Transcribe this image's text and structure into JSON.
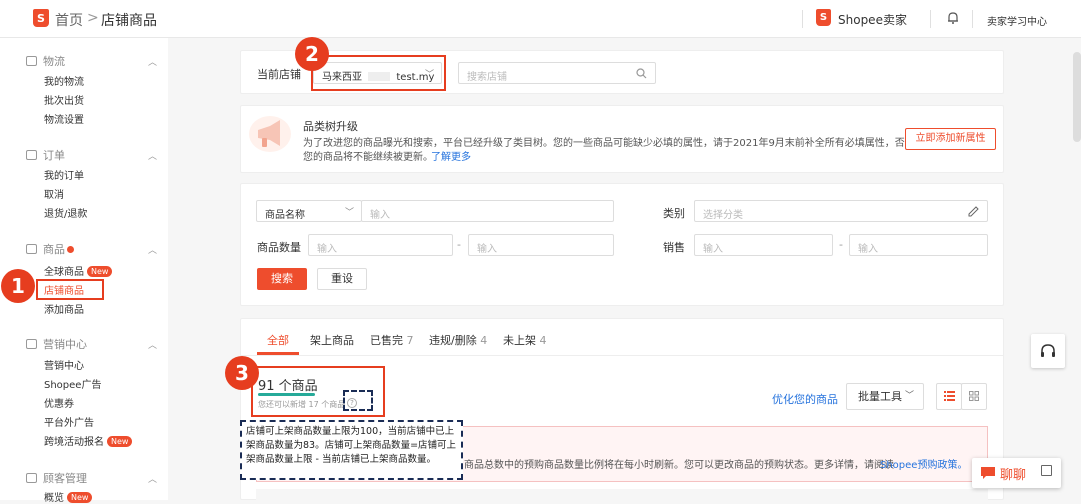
{
  "topbar": {
    "logo_glyph": "S",
    "home": "首页",
    "sep": ">",
    "current": "店铺商品",
    "brand": "Shopee卖家",
    "learn": "卖家学习中心"
  },
  "sidebar": {
    "sections": [
      {
        "label": "物流",
        "items": [
          "我的物流",
          "批次出货",
          "物流设置"
        ]
      },
      {
        "label": "订单",
        "items": [
          "我的订单",
          "取消",
          "退货/退款"
        ]
      },
      {
        "label": "商品",
        "items": [
          "全球商品",
          "店铺商品",
          "添加商品"
        ]
      },
      {
        "label": "营销中心",
        "items": [
          "营销中心",
          "Shopee广告",
          "优惠券",
          "平台外广告",
          "跨境活动报名"
        ]
      },
      {
        "label": "顾客管理",
        "items": [
          "概览"
        ]
      }
    ],
    "new_badge": "New"
  },
  "store": {
    "label": "当前店铺",
    "value_country": "马来西亚",
    "value_store": "test.my",
    "search_placeholder": "搜索店铺"
  },
  "notice": {
    "title": "品类树升级",
    "body_line1": "为了改进您的商品曝光和搜索，平台已经升级了类目树。您的一些商品可能缺少必填的属性，请于2021年9月末前补全所有必填属性，否则",
    "body_line2": "您的商品将不能继续被更新。",
    "learn_more": "了解更多",
    "action": "立即添加新属性"
  },
  "filters": {
    "name_select": "商品名称",
    "input_placeholder": "输入",
    "category_label": "类别",
    "category_placeholder": "选择分类",
    "qty_label": "商品数量",
    "sales_label": "销售",
    "dash": "-",
    "search_btn": "搜索",
    "reset_btn": "重设"
  },
  "tabs": [
    {
      "label": "全部",
      "count": ""
    },
    {
      "label": "架上商品",
      "count": ""
    },
    {
      "label": "已售完",
      "count": "7"
    },
    {
      "label": "违规/删除",
      "count": "4"
    },
    {
      "label": "未上架",
      "count": "4"
    }
  ],
  "products": {
    "count_title": "91 个商品",
    "sub": "您还可以新增 17 个商品",
    "optimize": "优化您的商品",
    "batch": "批量工具",
    "tooltip": "店铺可上架商品数量上限为100，当前店铺中已上架商品数量为83。店铺可上架商品数量=店铺可上架商品数量上限 - 当前店铺已上架商品数量。",
    "alert_text": "商品总数中的预购商品数量比例将在每小时刷新。您可以更改商品的预购状态。更多详情，请阅读",
    "alert_link": "Shopee预购政策。"
  },
  "annotations": [
    "1",
    "2",
    "3"
  ],
  "chat": {
    "label": "聊聊"
  },
  "colors": {
    "brand": "#ee4d2d",
    "annotation": "#e63d1f",
    "link": "#2673dd"
  },
  "icons": [
    "shopee-logo-icon",
    "bell-icon",
    "search-icon",
    "edit-icon",
    "megaphone-icon",
    "list-view-icon",
    "grid-view-icon",
    "headset-icon",
    "chat-icon"
  ]
}
